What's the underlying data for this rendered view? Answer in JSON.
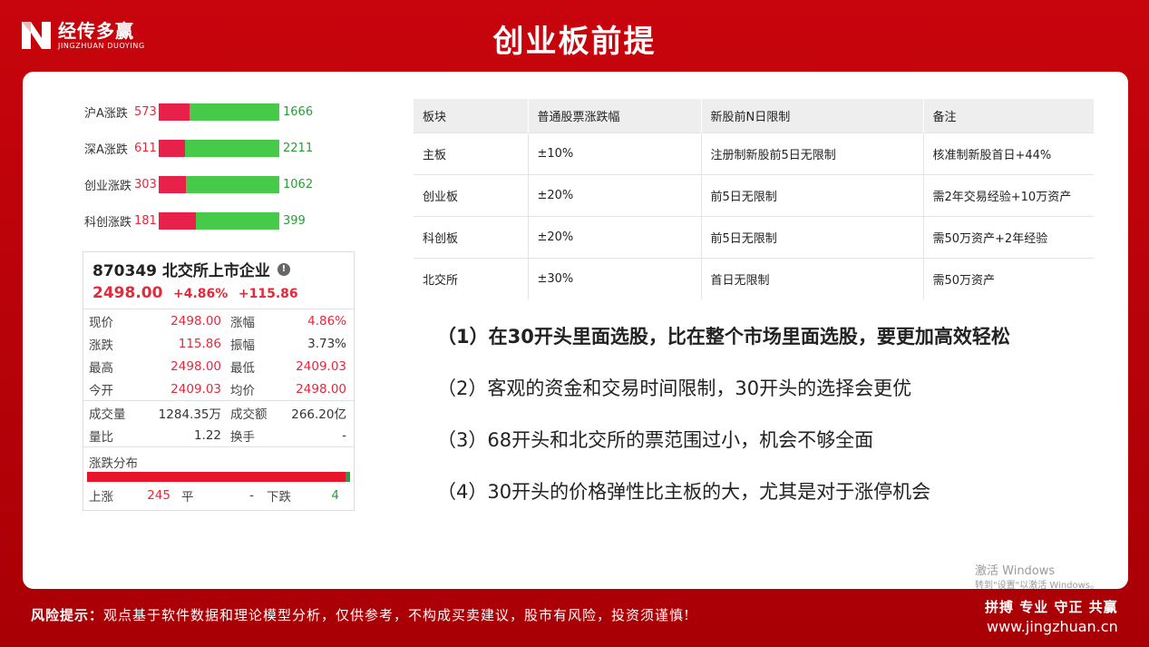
{
  "header": {
    "logo_cn": "经传多赢",
    "logo_en": "JINGZHUAN DUOYING",
    "title": "创业板前提"
  },
  "breadth": [
    {
      "label": "沪A涨跌",
      "up": "573",
      "down": "1666",
      "up_fraction": 0.256
    },
    {
      "label": "深A涨跌",
      "up": "611",
      "down": "2211",
      "up_fraction": 0.216
    },
    {
      "label": "创业涨跌",
      "up": "303",
      "down": "1062",
      "up_fraction": 0.222
    },
    {
      "label": "科创涨跌",
      "up": "181",
      "down": "399",
      "up_fraction": 0.312
    }
  ],
  "quote": {
    "title": "870349 北交所上市企业",
    "price": "2498.00",
    "change_pct": "+4.86%",
    "change": "+115.86",
    "rows": [
      {
        "k1": "现价",
        "v1": "2498.00",
        "k2": "涨幅",
        "v2": "4.86%"
      },
      {
        "k1": "涨跌",
        "v1": "115.86",
        "k2": "振幅",
        "v2": "3.73%"
      },
      {
        "k1": "最高",
        "v1": "2498.00",
        "k2": "最低",
        "v2": "2409.03"
      },
      {
        "k1": "今开",
        "v1": "2409.03",
        "k2": "均价",
        "v2": "2498.00"
      }
    ],
    "rows2": [
      {
        "k1": "成交量",
        "v1": "1284.35万",
        "k2": "成交额",
        "v2": "266.20亿"
      },
      {
        "k1": "量比",
        "v1": "1.22",
        "k2": "换手",
        "v2": "-"
      }
    ],
    "dist_label": "涨跌分布",
    "dist_up_fraction": 0.984,
    "up_label": "上涨",
    "up_count": "245",
    "flat_label": "平",
    "flat_count": "-",
    "down_label": "下跌",
    "down_count": "4"
  },
  "table": {
    "headers": [
      "板块",
      "普通股票涨跌幅",
      "新股前N日限制",
      "备注"
    ],
    "rows": [
      [
        "主板",
        "±10%",
        "注册制新股前5日无限制",
        "核准制新股首日+44%"
      ],
      [
        "创业板",
        "±20%",
        "前5日无限制",
        "需2年交易经验+10万资产"
      ],
      [
        "科创板",
        "±20%",
        "前5日无限制",
        "需50万资产+2年经验"
      ],
      [
        "北交所",
        "±30%",
        "首日无限制",
        "需50万资产"
      ]
    ]
  },
  "points": [
    {
      "num": "（1）",
      "text": "在30开头里面选股，比在整个市场里面选股，要更加高效轻松"
    },
    {
      "num": "（2）",
      "text": "客观的资金和交易时间限制，30开头的选择会更优"
    },
    {
      "num": "（3）",
      "text": "68开头和北交所的票范围过小，机会不够全面"
    },
    {
      "num": "（4）",
      "text": "30开头的价格弹性比主板的大，尤其是对于涨停机会"
    }
  ],
  "watermark": {
    "line1": "激活 Windows",
    "line2": "转到\"设置\"以激活 Windows。"
  },
  "footer": {
    "risk_label": "风险提示：",
    "risk_text": "观点基于软件数据和理论模型分析，仅供参考，不构成买卖建议，股市有风险，投资须谨慎!",
    "slogan": "拼搏 专业 守正 共赢",
    "site": "www.jingzhuan.cn"
  },
  "colors": {
    "brand_red": "#c8040d",
    "up_red": "#e8214a",
    "down_green": "#47c949"
  }
}
